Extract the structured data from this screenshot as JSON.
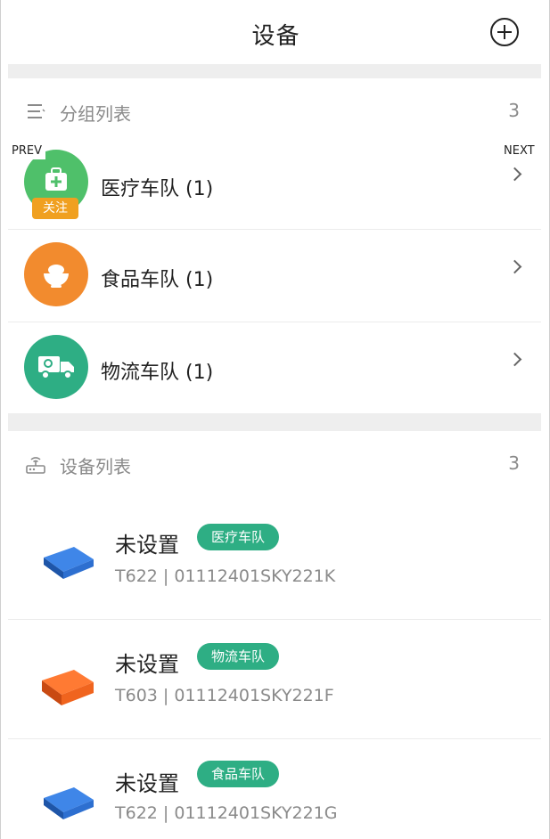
{
  "header": {
    "title": "设备",
    "add_icon": "plus-circle-icon"
  },
  "groups_section": {
    "label": "分组列表",
    "count": "3",
    "icon": "list-icon"
  },
  "nav": {
    "prev": "PREV",
    "next": "NEXT"
  },
  "groups": [
    {
      "label": "医疗车队 (1)",
      "icon": "medical-kit-icon",
      "color": "#4fc06a",
      "badge": "关注"
    },
    {
      "label": "食品车队 (1)",
      "icon": "food-bowl-icon",
      "color": "#f28b2e"
    },
    {
      "label": "物流车队 (1)",
      "icon": "truck-icon",
      "color": "#2eae84"
    }
  ],
  "devices_section": {
    "label": "设备列表",
    "count": "3",
    "icon": "router-icon"
  },
  "devices": [
    {
      "name": "未设置",
      "tag": "医疗车队",
      "sub": "T622 | 01112401SKY221K",
      "color": "#2d6fd0"
    },
    {
      "name": "未设置",
      "tag": "物流车队",
      "sub": "T603 | 01112401SKY221F",
      "color": "#f0641e"
    },
    {
      "name": "未设置",
      "tag": "食品车队",
      "sub": "T622 | 01112401SKY221G",
      "color": "#2d6fd0"
    }
  ],
  "colors": {
    "accent": "#2eae84",
    "badge": "#f0a020",
    "divider": "#eeeeee"
  }
}
